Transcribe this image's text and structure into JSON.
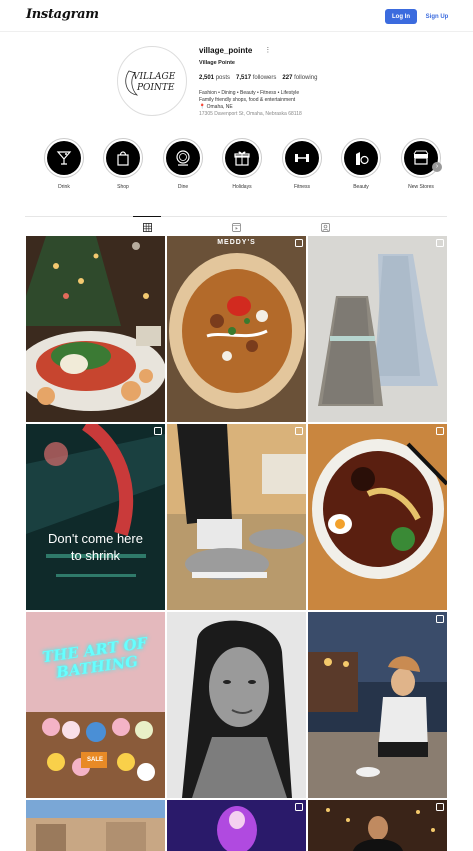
{
  "header": {
    "logo_text": "Instagram",
    "login_label": "Log In",
    "signup_label": "Sign Up"
  },
  "profile": {
    "username": "village_pointe",
    "more_label": "⋮",
    "full_name": "Village Pointe",
    "avatar_logo_line1": "VILLAGE",
    "avatar_logo_line2": "POINTE",
    "stats": {
      "posts_count": "2,501",
      "posts_label": "posts",
      "followers_count": "7,517",
      "followers_label": "followers",
      "following_count": "227",
      "following_label": "following"
    },
    "bio": {
      "line1": "Fashion • Dining • Beauty • Fitness • Lifestyle",
      "line2": "Family friendly shops, food & entertainment",
      "pin": "📍",
      "line3": "Omaha, NE",
      "address": "17305 Davenport St, Omaha, Nebraska 68118"
    }
  },
  "highlights": [
    {
      "label": "Drink",
      "icon": "martini-icon"
    },
    {
      "label": "Shop",
      "icon": "shopping-bag-icon"
    },
    {
      "label": "Dine",
      "icon": "plate-icon"
    },
    {
      "label": "Holidays",
      "icon": "gift-icon"
    },
    {
      "label": "Fitness",
      "icon": "dumbbell-icon"
    },
    {
      "label": "Beauty",
      "icon": "lipstick-icon"
    },
    {
      "label": "New Stores",
      "icon": "store-icon"
    }
  ],
  "highlight_next_icon": "chevron-right-icon",
  "tabs": [
    {
      "name": "posts",
      "icon": "grid-icon",
      "active": true
    },
    {
      "name": "reels",
      "icon": "reels-icon",
      "active": false
    },
    {
      "name": "tagged",
      "icon": "tagged-icon",
      "active": false
    }
  ],
  "posts": {
    "p2_brand": "MEDDY'S",
    "p4_caption_line1": "Don't come here",
    "p4_caption_line2": "to shrink",
    "p7_neon_line1": "THE ART OF",
    "p7_neon_line2": "BATHING",
    "p7_sign": "SALE"
  },
  "colors": {
    "accent": "#3b6bde",
    "text": "#262626"
  }
}
